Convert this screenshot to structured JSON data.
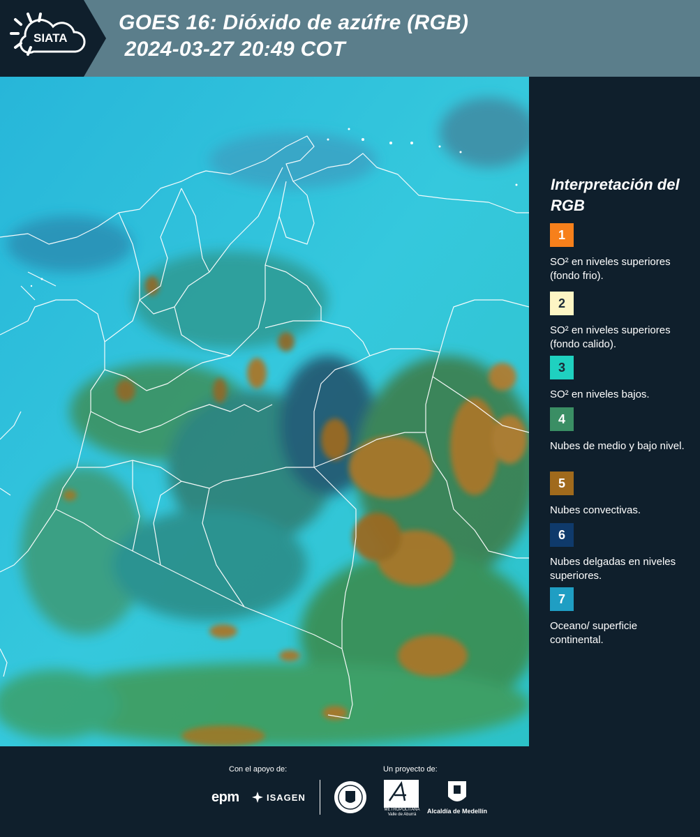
{
  "header": {
    "logo_text": "SIATA",
    "title_line1": "GOES 16: Dióxido de azúfre (RGB)",
    "title_line2": " 2024-03-27 20:49 COT",
    "background_color": "#5b7e8b",
    "logo_background_color": "#0f1f2c"
  },
  "map": {
    "description_icon": "satellite-rgb-map",
    "ocean_color": "#2fc3dc",
    "cloud_color_mid_low": "#3d8f5a",
    "cloud_color_convective": "#a8772a",
    "boundary_color": "#ffffff"
  },
  "legend": {
    "title": "Interpretación del RGB",
    "items": [
      {
        "number": "1",
        "color": "#f7801b",
        "number_color": "#ffffff",
        "label": "SO² en niveles superiores (fondo frio)."
      },
      {
        "number": "2",
        "color": "#fdf5c4",
        "number_color": "#1b2a36",
        "label": "SO² en niveles superiores (fondo calido)."
      },
      {
        "number": "3",
        "color": "#1fd1c0",
        "number_color": "#1b2a36",
        "label": "SO² en niveles bajos."
      },
      {
        "number": "4",
        "color": "#3a8e64",
        "number_color": "#ffffff",
        "label": "Nubes de medio y bajo nivel."
      },
      {
        "number": "5",
        "color": "#a06a1c",
        "number_color": "#ffffff",
        "label": "Nubes convectivas."
      },
      {
        "number": "6",
        "color": "#0f3a6b",
        "number_color": "#ffffff",
        "label": "Nubes delgadas en niveles superiores."
      },
      {
        "number": "7",
        "color": "#1f9ec3",
        "number_color": "#ffffff",
        "label": "Oceano/ superficie continental."
      }
    ]
  },
  "footer": {
    "support_label": "Con el apoyo de:",
    "project_label": "Un proyecto de:",
    "sponsor_epm": "epm",
    "sponsor_isagen": "ISAGEN",
    "area_text": "METROPOLITANA Valle de Aburrá",
    "alcaldia_text": "Alcaldía de Medellín"
  }
}
